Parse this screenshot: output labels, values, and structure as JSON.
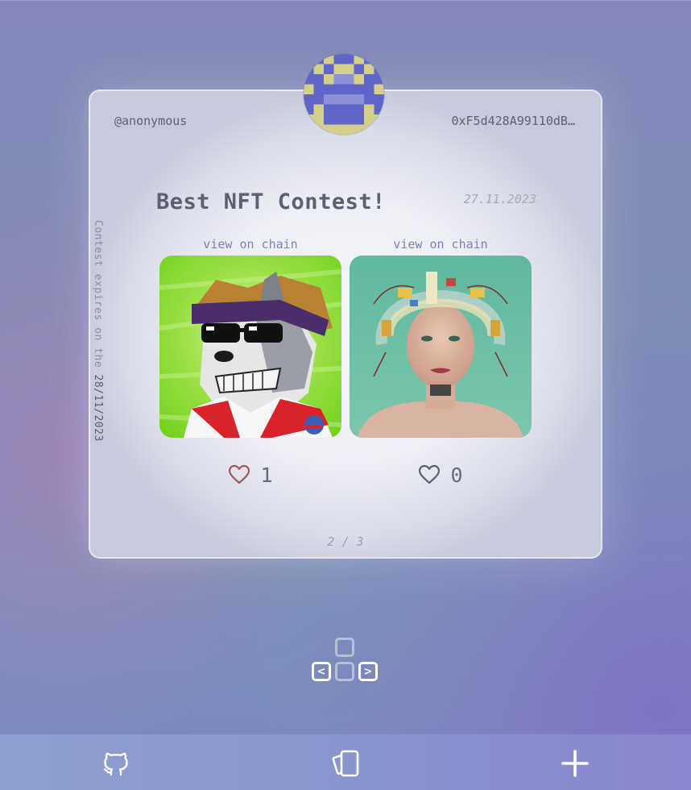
{
  "card": {
    "username": "@anonymous",
    "address": "0xF5d428A99110dB…",
    "side_text_prefix": "Contest expires on the",
    "side_text_date": "28/11/2023",
    "title": "Best NFT Contest!",
    "date": "27.11.2023",
    "entries": [
      {
        "link_label": "view on chain",
        "likes": "1",
        "heart": "heart-outline-red",
        "image": "pixel-art-wolf-with-sunglasses"
      },
      {
        "link_label": "view on chain",
        "likes": "0",
        "heart": "heart-outline-gray",
        "image": "woman-with-circuit-helmet"
      }
    ],
    "pager": "2 / 3"
  },
  "keys": {
    "left_label": "<",
    "right_label": ">"
  },
  "bottom_bar": {
    "icons": [
      "github-icon",
      "cards-icon",
      "plus-icon"
    ]
  },
  "colors": {
    "liked_heart": "#a25a5a",
    "unliked_heart": "#5f636f",
    "link": "#7d83bb",
    "avatar_blue": "#6065c8",
    "avatar_yellow": "#d4cf8a"
  }
}
